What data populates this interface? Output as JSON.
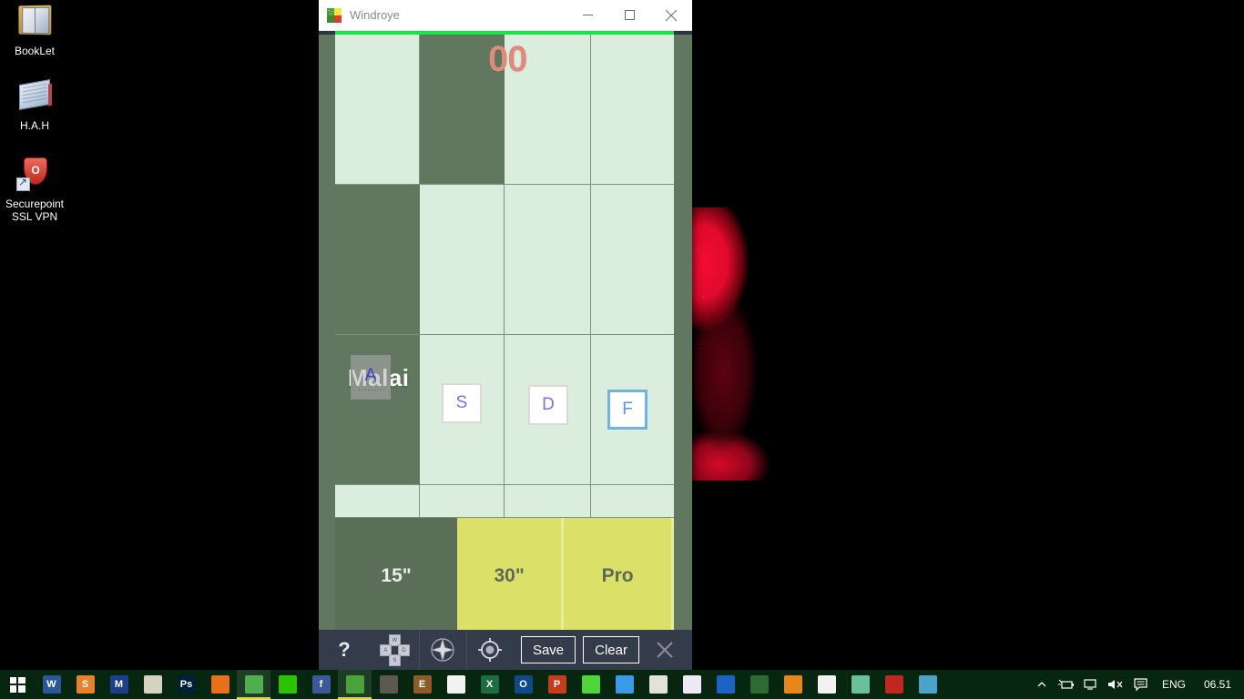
{
  "desktop": {
    "icons": [
      {
        "label": "BookLet",
        "icon": "book-icon"
      },
      {
        "label": "H.A.H",
        "icon": "notepad-icon"
      },
      {
        "label": "Securepoint\nSSL VPN",
        "label_line1": "Securepoint",
        "label_line2": "SSL VPN",
        "icon": "shield-shortcut-icon"
      }
    ]
  },
  "window": {
    "title": "Windroye",
    "icon": "windroye-app-icon",
    "minimize_label": "minimize-icon",
    "maximize_label": "maximize-icon",
    "close_label": "close-icon",
    "accent_color": "#1ce14a"
  },
  "canvas": {
    "score": "00",
    "score_color": "#dd8b7c",
    "word": "Malai",
    "keys": [
      {
        "letter": "A",
        "state": "placed"
      },
      {
        "letter": "S",
        "state": "available"
      },
      {
        "letter": "D",
        "state": "available"
      },
      {
        "letter": "F",
        "state": "selected"
      }
    ],
    "actions": [
      {
        "label": "15\"",
        "style": "dark"
      },
      {
        "label": "30\"",
        "style": "lime"
      },
      {
        "label": "Pro",
        "style": "lime"
      }
    ],
    "grid": {
      "lite_color": "#dbeedd",
      "dark_color": "#61775f",
      "line_color": "#7c9479"
    }
  },
  "toolbar": {
    "help_label": "?",
    "wasd": {
      "up": "W",
      "left": "A",
      "right": "D",
      "down": "S"
    },
    "compass_icon": "compass-star-icon",
    "target_icon": "crosshair-target-icon",
    "save_label": "Save",
    "clear_label": "Clear",
    "close_icon": "close-icon"
  },
  "taskbar": {
    "start_label": "start-button",
    "apps": [
      {
        "name": "word",
        "text": "W",
        "bg": "#2b579a"
      },
      {
        "name": "app-orange",
        "text": "S",
        "bg": "#e8812d"
      },
      {
        "name": "app-m-blue",
        "text": "M",
        "bg": "#1b3f8b"
      },
      {
        "name": "app-multi",
        "text": "",
        "bg": "#d8d2c2"
      },
      {
        "name": "photoshop",
        "text": "Ps",
        "bg": "#001e36"
      },
      {
        "name": "firefox",
        "text": "",
        "bg": "#e8701a"
      },
      {
        "name": "winrar",
        "text": "",
        "bg": "#4fae4f"
      },
      {
        "name": "wechat",
        "text": "",
        "bg": "#2dc100"
      },
      {
        "name": "facebook",
        "text": "f",
        "bg": "#3b5998"
      },
      {
        "name": "windroye",
        "text": "",
        "bg": "#4ba23d"
      },
      {
        "name": "compass-app",
        "text": "",
        "bg": "#5c5a4e"
      },
      {
        "name": "ebook",
        "text": "E",
        "bg": "#8a5d2b"
      },
      {
        "name": "store",
        "text": "",
        "bg": "#f2f2f2"
      },
      {
        "name": "excel",
        "text": "X",
        "bg": "#1e6c41"
      },
      {
        "name": "outlook",
        "text": "O",
        "bg": "#0f4a8a"
      },
      {
        "name": "powerpoint",
        "text": "P",
        "bg": "#c43e1c"
      },
      {
        "name": "spotify",
        "text": "",
        "bg": "#4fd43a"
      },
      {
        "name": "messenger",
        "text": "",
        "bg": "#3b9ae8"
      },
      {
        "name": "notepad",
        "text": "",
        "bg": "#e2e2d8"
      },
      {
        "name": "paint",
        "text": "",
        "bg": "#f0e9f5"
      },
      {
        "name": "windows-app",
        "text": "",
        "bg": "#1b64c4"
      },
      {
        "name": "leaf-app",
        "text": "",
        "bg": "#2e6b34"
      },
      {
        "name": "media-player",
        "text": "",
        "bg": "#e8861a"
      },
      {
        "name": "calculator",
        "text": "",
        "bg": "#f2f2f2"
      },
      {
        "name": "photos",
        "text": "",
        "bg": "#6bbf9b"
      },
      {
        "name": "ant-app",
        "text": "",
        "bg": "#c0281f"
      },
      {
        "name": "browser-app",
        "text": "",
        "bg": "#4aa3c8"
      }
    ],
    "tray": {
      "chevron": "chevron-up-icon",
      "battery": "battery-icon",
      "network": "network-icon",
      "volume": "volume-muted-icon",
      "action_center": "action-center-icon",
      "language": "ENG",
      "time": "06.51"
    }
  }
}
